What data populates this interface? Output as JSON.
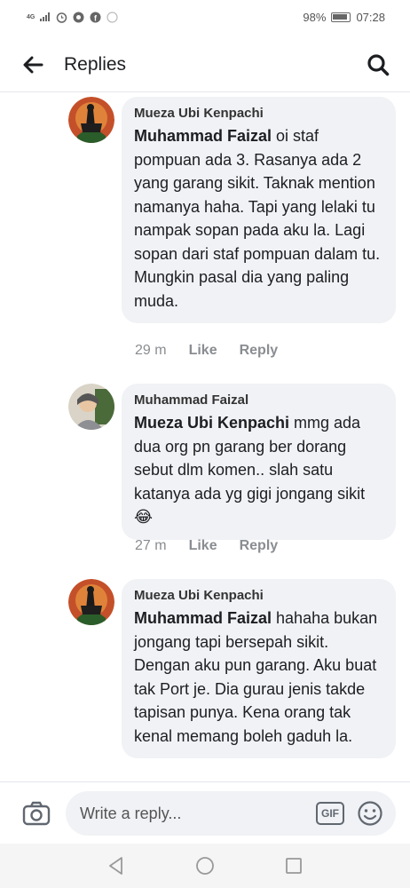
{
  "status_bar": {
    "network": "4G",
    "battery": "98%",
    "time": "07:28"
  },
  "header": {
    "title": "Replies",
    "back_icon": "arrow-left-icon",
    "search_icon": "search-icon"
  },
  "comments": [
    {
      "author": "Mueza Ubi Kenpachi",
      "mention": "Muhammad Faizal",
      "text": " oi staf pompuan ada 3. Rasanya ada 2 yang garang sikit. Taknak mention namanya haha. Tapi yang lelaki tu nampak sopan pada aku la. Lagi sopan dari staf pompuan dalam tu. Mungkin pasal dia yang paling muda.",
      "time": "29 m",
      "like_label": "Like",
      "reply_label": "Reply"
    },
    {
      "author": "Muhammad Faizal",
      "mention": "Mueza Ubi Kenpachi",
      "text": " mmg ada dua org pn garang ber dorang sebut dlm komen.. slah satu katanya ada yg gigi jongang sikit😂",
      "time": "27 m",
      "like_label": "Like",
      "reply_label": "Reply"
    },
    {
      "author": "Mueza Ubi Kenpachi",
      "mention": "Muhammad Faizal",
      "text": " hahaha bukan jongang tapi bersepah sikit. Dengan aku pun garang. Aku buat tak Port je. Dia gurau jenis takde tapisan punya. Kena orang tak kenal memang boleh gaduh la."
    }
  ],
  "composer": {
    "placeholder": "Write a reply...",
    "gif_label": "GIF",
    "camera_icon": "camera-icon",
    "emoji_icon": "smiley-icon"
  },
  "nav": {
    "back_icon": "triangle-back-icon",
    "home_icon": "circle-home-icon",
    "recents_icon": "square-recents-icon"
  }
}
